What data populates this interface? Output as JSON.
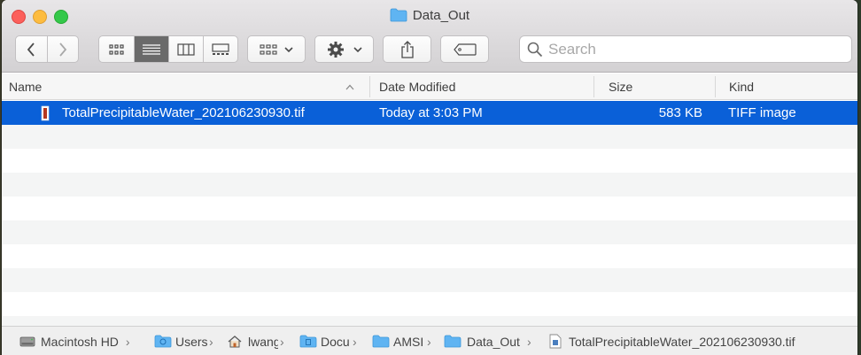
{
  "window": {
    "title": "Data_Out",
    "title_icon": "folder-icon"
  },
  "toolbar": {
    "back_icon": "chevron-left-icon",
    "forward_icon": "chevron-right-icon",
    "view_modes": [
      "icon-view",
      "list-view",
      "column-view",
      "gallery-view"
    ],
    "active_view": "list-view",
    "group_icon": "group-grid-icon",
    "action_icon": "gear-icon",
    "share_icon": "share-icon",
    "tags_icon": "tag-icon",
    "search_placeholder": "Search"
  },
  "columns": {
    "name": "Name",
    "date_modified": "Date Modified",
    "size": "Size",
    "kind": "Kind",
    "sort_indicator": "^"
  },
  "files": [
    {
      "name": "TotalPrecipitableWater_202106230930.tif",
      "date_modified": "Today at 3:03 PM",
      "size": "583 KB",
      "kind": "TIFF image",
      "selected": true
    }
  ],
  "path": [
    {
      "label": "Macintosh HD",
      "icon": "hard-drive-icon"
    },
    {
      "label": "Users",
      "icon": "users-folder-icon"
    },
    {
      "label": "lwang",
      "icon": "home-icon"
    },
    {
      "label": "Docu",
      "icon": "documents-folder-icon"
    },
    {
      "label": "AMSI",
      "icon": "folder-icon"
    },
    {
      "label": "Data_Out",
      "icon": "folder-icon"
    },
    {
      "label": "TotalPrecipitableWater_202106230930.tif",
      "icon": "tiff-file-icon"
    }
  ],
  "colors": {
    "selection": "#0a60d8",
    "folder": "#5fb4f2",
    "stripe": "#f4f5f5"
  }
}
